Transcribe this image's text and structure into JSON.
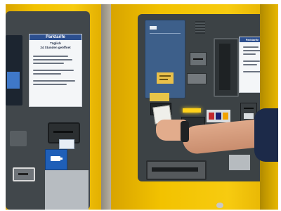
{
  "left_sign": {
    "title": "Parktarife",
    "subtitle_line1": "Täglich",
    "subtitle_line2": "24 Stunden geöffnet"
  },
  "right_sign": {
    "title": "Parktarife"
  },
  "colors": {
    "machine_yellow": "#f2c200",
    "panel_gray": "#3f4447",
    "sign_blue": "#2c4f8f",
    "display_blue": "#3d5f8a",
    "ticket_label_yellow": "#e9c04a"
  }
}
